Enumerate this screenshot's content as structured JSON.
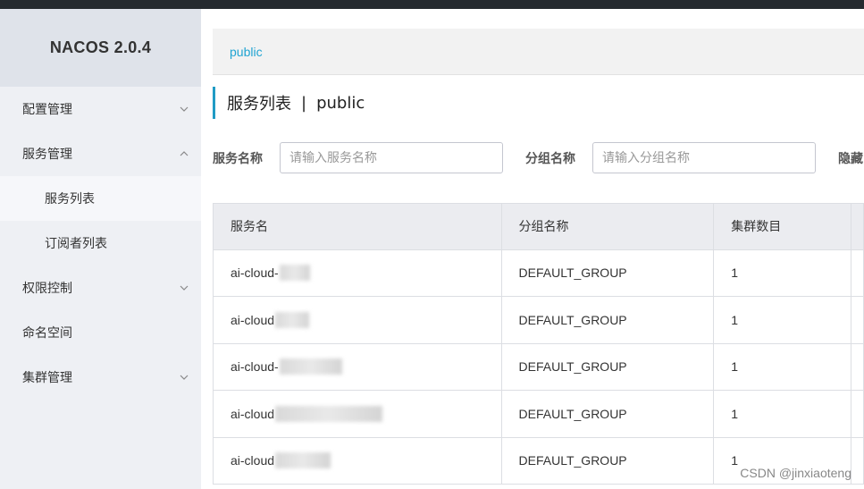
{
  "app": {
    "brand": "NACOS 2.0.4"
  },
  "sidebar": {
    "items": [
      {
        "label": "配置管理",
        "expanded": false,
        "has_chevron": true
      },
      {
        "label": "服务管理",
        "expanded": true,
        "has_chevron": true
      },
      {
        "label": "服务列表",
        "sub": true,
        "active": true
      },
      {
        "label": "订阅者列表",
        "sub": true
      },
      {
        "label": "权限控制",
        "expanded": false,
        "has_chevron": true
      },
      {
        "label": "命名空间",
        "has_chevron": false
      },
      {
        "label": "集群管理",
        "expanded": false,
        "has_chevron": true
      }
    ]
  },
  "breadcrumb": {
    "namespace": "public"
  },
  "page": {
    "title": "服务列表",
    "separator": "|",
    "namespace": "public"
  },
  "filters": {
    "service_name_label": "服务名称",
    "service_name_placeholder": "请输入服务名称",
    "group_name_label": "分组名称",
    "group_name_placeholder": "请输入分组名称",
    "hide_empty_label": "隐藏"
  },
  "table": {
    "headers": [
      "服务名",
      "分组名称",
      "集群数目"
    ],
    "rows": [
      {
        "service": "ai-cloud-",
        "group": "DEFAULT_GROUP",
        "clusters": "1"
      },
      {
        "service": "ai-cloud",
        "group": "DEFAULT_GROUP",
        "clusters": "1"
      },
      {
        "service": "ai-cloud-",
        "group": "DEFAULT_GROUP",
        "clusters": "1"
      },
      {
        "service": "ai-cloud",
        "group": "DEFAULT_GROUP",
        "clusters": "1"
      },
      {
        "service": "ai-cloud",
        "group": "DEFAULT_GROUP",
        "clusters": "1"
      }
    ]
  },
  "watermark": "CSDN @jinxiaoteng",
  "colors": {
    "accent": "#209bc5",
    "link": "#21a4d2",
    "topbar": "#252a2f"
  }
}
